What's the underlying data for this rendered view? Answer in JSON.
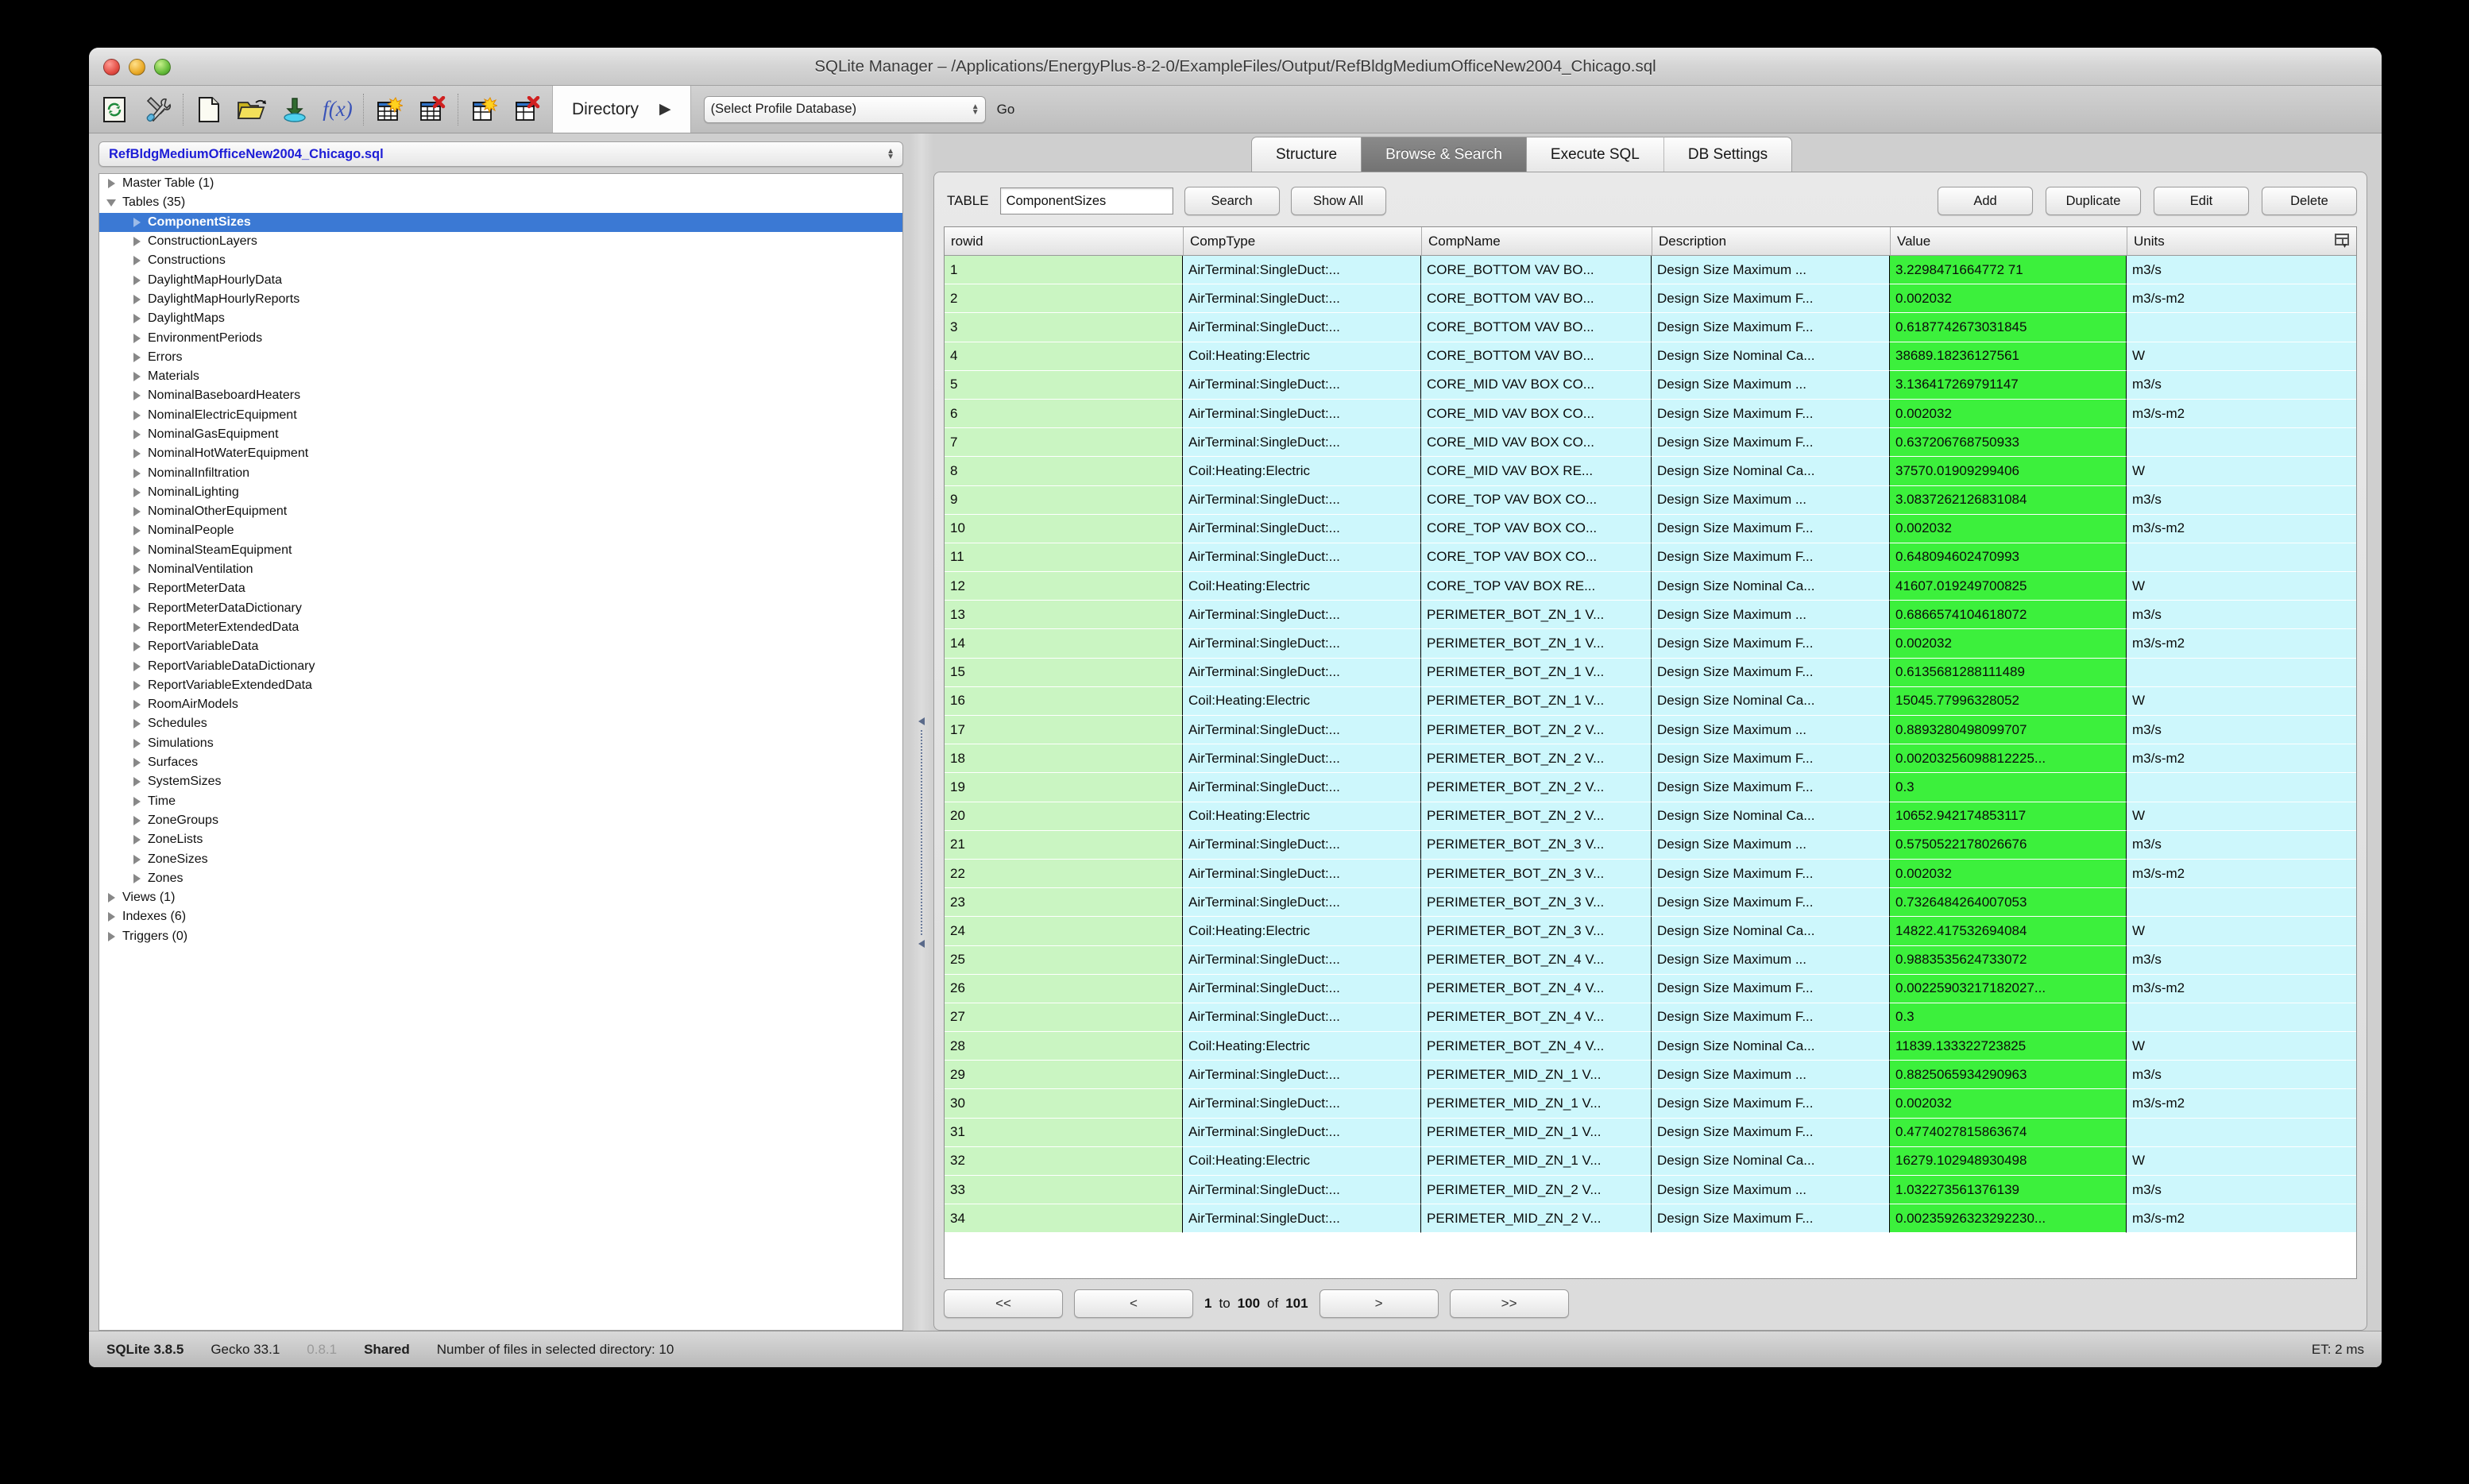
{
  "window": {
    "title": "SQLite Manager – /Applications/EnergyPlus-8-2-0/ExampleFiles/Output/RefBldgMediumOfficeNew2004_Chicago.sql"
  },
  "toolbar": {
    "icons": [
      "refresh-icon",
      "tools-icon",
      "new-database-icon",
      "open-database-icon",
      "import-icon",
      "function-icon",
      "new-table-icon",
      "drop-table-icon",
      "new-view-icon",
      "drop-view-icon"
    ],
    "directory_label": "Directory",
    "directory_arrow": "▶",
    "profile_value": "(Select Profile Database)",
    "go_label": "Go"
  },
  "sidebar": {
    "database_label": "RefBldgMediumOfficeNew2004_Chicago.sql",
    "items": [
      {
        "label": "Master Table (1)",
        "level": 0,
        "expanded": false,
        "selected": false
      },
      {
        "label": "Tables (35)",
        "level": 0,
        "expanded": true,
        "selected": false
      },
      {
        "label": "ComponentSizes",
        "level": 1,
        "expanded": false,
        "selected": true
      },
      {
        "label": "ConstructionLayers",
        "level": 1,
        "expanded": false,
        "selected": false
      },
      {
        "label": "Constructions",
        "level": 1,
        "expanded": false,
        "selected": false
      },
      {
        "label": "DaylightMapHourlyData",
        "level": 1,
        "expanded": false,
        "selected": false
      },
      {
        "label": "DaylightMapHourlyReports",
        "level": 1,
        "expanded": false,
        "selected": false
      },
      {
        "label": "DaylightMaps",
        "level": 1,
        "expanded": false,
        "selected": false
      },
      {
        "label": "EnvironmentPeriods",
        "level": 1,
        "expanded": false,
        "selected": false
      },
      {
        "label": "Errors",
        "level": 1,
        "expanded": false,
        "selected": false
      },
      {
        "label": "Materials",
        "level": 1,
        "expanded": false,
        "selected": false
      },
      {
        "label": "NominalBaseboardHeaters",
        "level": 1,
        "expanded": false,
        "selected": false
      },
      {
        "label": "NominalElectricEquipment",
        "level": 1,
        "expanded": false,
        "selected": false
      },
      {
        "label": "NominalGasEquipment",
        "level": 1,
        "expanded": false,
        "selected": false
      },
      {
        "label": "NominalHotWaterEquipment",
        "level": 1,
        "expanded": false,
        "selected": false
      },
      {
        "label": "NominalInfiltration",
        "level": 1,
        "expanded": false,
        "selected": false
      },
      {
        "label": "NominalLighting",
        "level": 1,
        "expanded": false,
        "selected": false
      },
      {
        "label": "NominalOtherEquipment",
        "level": 1,
        "expanded": false,
        "selected": false
      },
      {
        "label": "NominalPeople",
        "level": 1,
        "expanded": false,
        "selected": false
      },
      {
        "label": "NominalSteamEquipment",
        "level": 1,
        "expanded": false,
        "selected": false
      },
      {
        "label": "NominalVentilation",
        "level": 1,
        "expanded": false,
        "selected": false
      },
      {
        "label": "ReportMeterData",
        "level": 1,
        "expanded": false,
        "selected": false
      },
      {
        "label": "ReportMeterDataDictionary",
        "level": 1,
        "expanded": false,
        "selected": false
      },
      {
        "label": "ReportMeterExtendedData",
        "level": 1,
        "expanded": false,
        "selected": false
      },
      {
        "label": "ReportVariableData",
        "level": 1,
        "expanded": false,
        "selected": false
      },
      {
        "label": "ReportVariableDataDictionary",
        "level": 1,
        "expanded": false,
        "selected": false
      },
      {
        "label": "ReportVariableExtendedData",
        "level": 1,
        "expanded": false,
        "selected": false
      },
      {
        "label": "RoomAirModels",
        "level": 1,
        "expanded": false,
        "selected": false
      },
      {
        "label": "Schedules",
        "level": 1,
        "expanded": false,
        "selected": false
      },
      {
        "label": "Simulations",
        "level": 1,
        "expanded": false,
        "selected": false
      },
      {
        "label": "Surfaces",
        "level": 1,
        "expanded": false,
        "selected": false
      },
      {
        "label": "SystemSizes",
        "level": 1,
        "expanded": false,
        "selected": false
      },
      {
        "label": "Time",
        "level": 1,
        "expanded": false,
        "selected": false
      },
      {
        "label": "ZoneGroups",
        "level": 1,
        "expanded": false,
        "selected": false
      },
      {
        "label": "ZoneLists",
        "level": 1,
        "expanded": false,
        "selected": false
      },
      {
        "label": "ZoneSizes",
        "level": 1,
        "expanded": false,
        "selected": false
      },
      {
        "label": "Zones",
        "level": 1,
        "expanded": false,
        "selected": false
      },
      {
        "label": "Views (1)",
        "level": 0,
        "expanded": false,
        "selected": false
      },
      {
        "label": "Indexes (6)",
        "level": 0,
        "expanded": false,
        "selected": false
      },
      {
        "label": "Triggers (0)",
        "level": 0,
        "expanded": false,
        "selected": false
      }
    ]
  },
  "tabs": [
    {
      "label": "Structure",
      "active": false
    },
    {
      "label": "Browse & Search",
      "active": true
    },
    {
      "label": "Execute SQL",
      "active": false
    },
    {
      "label": "DB Settings",
      "active": false
    }
  ],
  "controls": {
    "table_label": "TABLE",
    "table_value": "ComponentSizes",
    "search_label": "Search",
    "show_all_label": "Show All",
    "add_label": "Add",
    "duplicate_label": "Duplicate",
    "edit_label": "Edit",
    "delete_label": "Delete",
    "column_picker_icon": "column-picker-icon"
  },
  "grid": {
    "columns": [
      "rowid",
      "CompType",
      "CompName",
      "Description",
      "Value",
      "Units"
    ],
    "rows": [
      [
        "1",
        "AirTerminal:SingleDuct:...",
        "CORE_BOTTOM VAV BO...",
        "Design Size Maximum ...",
        "3.2298471664772 71",
        "m3/s"
      ],
      [
        "2",
        "AirTerminal:SingleDuct:...",
        "CORE_BOTTOM VAV BO...",
        "Design Size Maximum F...",
        "0.002032",
        "m3/s-m2"
      ],
      [
        "3",
        "AirTerminal:SingleDuct:...",
        "CORE_BOTTOM VAV BO...",
        "Design Size Maximum F...",
        "0.6187742673031845",
        ""
      ],
      [
        "4",
        "Coil:Heating:Electric",
        "CORE_BOTTOM VAV BO...",
        "Design Size Nominal Ca...",
        "38689.18236127561",
        "W"
      ],
      [
        "5",
        "AirTerminal:SingleDuct:...",
        "CORE_MID VAV BOX CO...",
        "Design Size Maximum ...",
        "3.136417269791147",
        "m3/s"
      ],
      [
        "6",
        "AirTerminal:SingleDuct:...",
        "CORE_MID VAV BOX CO...",
        "Design Size Maximum F...",
        "0.002032",
        "m3/s-m2"
      ],
      [
        "7",
        "AirTerminal:SingleDuct:...",
        "CORE_MID VAV BOX CO...",
        "Design Size Maximum F...",
        "0.637206768750933",
        ""
      ],
      [
        "8",
        "Coil:Heating:Electric",
        "CORE_MID VAV BOX RE...",
        "Design Size Nominal Ca...",
        "37570.01909299406",
        "W"
      ],
      [
        "9",
        "AirTerminal:SingleDuct:...",
        "CORE_TOP VAV BOX CO...",
        "Design Size Maximum ...",
        "3.0837262126831084",
        "m3/s"
      ],
      [
        "10",
        "AirTerminal:SingleDuct:...",
        "CORE_TOP VAV BOX CO...",
        "Design Size Maximum F...",
        "0.002032",
        "m3/s-m2"
      ],
      [
        "11",
        "AirTerminal:SingleDuct:...",
        "CORE_TOP VAV BOX CO...",
        "Design Size Maximum F...",
        "0.648094602470993",
        ""
      ],
      [
        "12",
        "Coil:Heating:Electric",
        "CORE_TOP VAV BOX RE...",
        "Design Size Nominal Ca...",
        "41607.019249700825",
        "W"
      ],
      [
        "13",
        "AirTerminal:SingleDuct:...",
        "PERIMETER_BOT_ZN_1 V...",
        "Design Size Maximum ...",
        "0.6866574104618072",
        "m3/s"
      ],
      [
        "14",
        "AirTerminal:SingleDuct:...",
        "PERIMETER_BOT_ZN_1 V...",
        "Design Size Maximum F...",
        "0.002032",
        "m3/s-m2"
      ],
      [
        "15",
        "AirTerminal:SingleDuct:...",
        "PERIMETER_BOT_ZN_1 V...",
        "Design Size Maximum F...",
        "0.6135681288111489",
        ""
      ],
      [
        "16",
        "Coil:Heating:Electric",
        "PERIMETER_BOT_ZN_1 V...",
        "Design Size Nominal Ca...",
        "15045.77996328052",
        "W"
      ],
      [
        "17",
        "AirTerminal:SingleDuct:...",
        "PERIMETER_BOT_ZN_2 V...",
        "Design Size Maximum ...",
        "0.8893280498099707",
        "m3/s"
      ],
      [
        "18",
        "AirTerminal:SingleDuct:...",
        "PERIMETER_BOT_ZN_2 V...",
        "Design Size Maximum F...",
        "0.00203256098812225...",
        "m3/s-m2"
      ],
      [
        "19",
        "AirTerminal:SingleDuct:...",
        "PERIMETER_BOT_ZN_2 V...",
        "Design Size Maximum F...",
        "0.3",
        ""
      ],
      [
        "20",
        "Coil:Heating:Electric",
        "PERIMETER_BOT_ZN_2 V...",
        "Design Size Nominal Ca...",
        "10652.942174853117",
        "W"
      ],
      [
        "21",
        "AirTerminal:SingleDuct:...",
        "PERIMETER_BOT_ZN_3 V...",
        "Design Size Maximum ...",
        "0.5750522178026676",
        "m3/s"
      ],
      [
        "22",
        "AirTerminal:SingleDuct:...",
        "PERIMETER_BOT_ZN_3 V...",
        "Design Size Maximum F...",
        "0.002032",
        "m3/s-m2"
      ],
      [
        "23",
        "AirTerminal:SingleDuct:...",
        "PERIMETER_BOT_ZN_3 V...",
        "Design Size Maximum F...",
        "0.7326484264007053",
        ""
      ],
      [
        "24",
        "Coil:Heating:Electric",
        "PERIMETER_BOT_ZN_3 V...",
        "Design Size Nominal Ca...",
        "14822.417532694084",
        "W"
      ],
      [
        "25",
        "AirTerminal:SingleDuct:...",
        "PERIMETER_BOT_ZN_4 V...",
        "Design Size Maximum ...",
        "0.9883535624733072",
        "m3/s"
      ],
      [
        "26",
        "AirTerminal:SingleDuct:...",
        "PERIMETER_BOT_ZN_4 V...",
        "Design Size Maximum F...",
        "0.00225903217182027...",
        "m3/s-m2"
      ],
      [
        "27",
        "AirTerminal:SingleDuct:...",
        "PERIMETER_BOT_ZN_4 V...",
        "Design Size Maximum F...",
        "0.3",
        ""
      ],
      [
        "28",
        "Coil:Heating:Electric",
        "PERIMETER_BOT_ZN_4 V...",
        "Design Size Nominal Ca...",
        "11839.133322723825",
        "W"
      ],
      [
        "29",
        "AirTerminal:SingleDuct:...",
        "PERIMETER_MID_ZN_1 V...",
        "Design Size Maximum ...",
        "0.8825065934290963",
        "m3/s"
      ],
      [
        "30",
        "AirTerminal:SingleDuct:...",
        "PERIMETER_MID_ZN_1 V...",
        "Design Size Maximum F...",
        "0.002032",
        "m3/s-m2"
      ],
      [
        "31",
        "AirTerminal:SingleDuct:...",
        "PERIMETER_MID_ZN_1 V...",
        "Design Size Maximum F...",
        "0.4774027815863674",
        ""
      ],
      [
        "32",
        "Coil:Heating:Electric",
        "PERIMETER_MID_ZN_1 V...",
        "Design Size Nominal Ca...",
        "16279.102948930498",
        "W"
      ],
      [
        "33",
        "AirTerminal:SingleDuct:...",
        "PERIMETER_MID_ZN_2 V...",
        "Design Size Maximum ...",
        "1.032273561376139",
        "m3/s"
      ],
      [
        "34",
        "AirTerminal:SingleDuct:...",
        "PERIMETER_MID_ZN_2 V...",
        "Design Size Maximum F...",
        "0.00235926323292230...",
        "m3/s-m2"
      ]
    ]
  },
  "pager": {
    "first_label": "<<",
    "prev_label": "<",
    "from": "1",
    "to_word": "to",
    "to": "100",
    "of_word": "of",
    "total": "101",
    "next_label": ">",
    "last_label": ">>"
  },
  "status": {
    "sqlite_version": "SQLite 3.8.5",
    "gecko_version": "Gecko 33.1",
    "app_version": "0.8.1",
    "mode": "Shared",
    "files_message": "Number of files in selected directory: 10",
    "elapsed": "ET: 2 ms"
  },
  "colors": {
    "selection": "#3b79d4",
    "value_cell": "#3cf03c",
    "rowid_cell": "#caf5c2",
    "data_cell": "#cdf7fc",
    "db_name": "#1d1dd6"
  }
}
